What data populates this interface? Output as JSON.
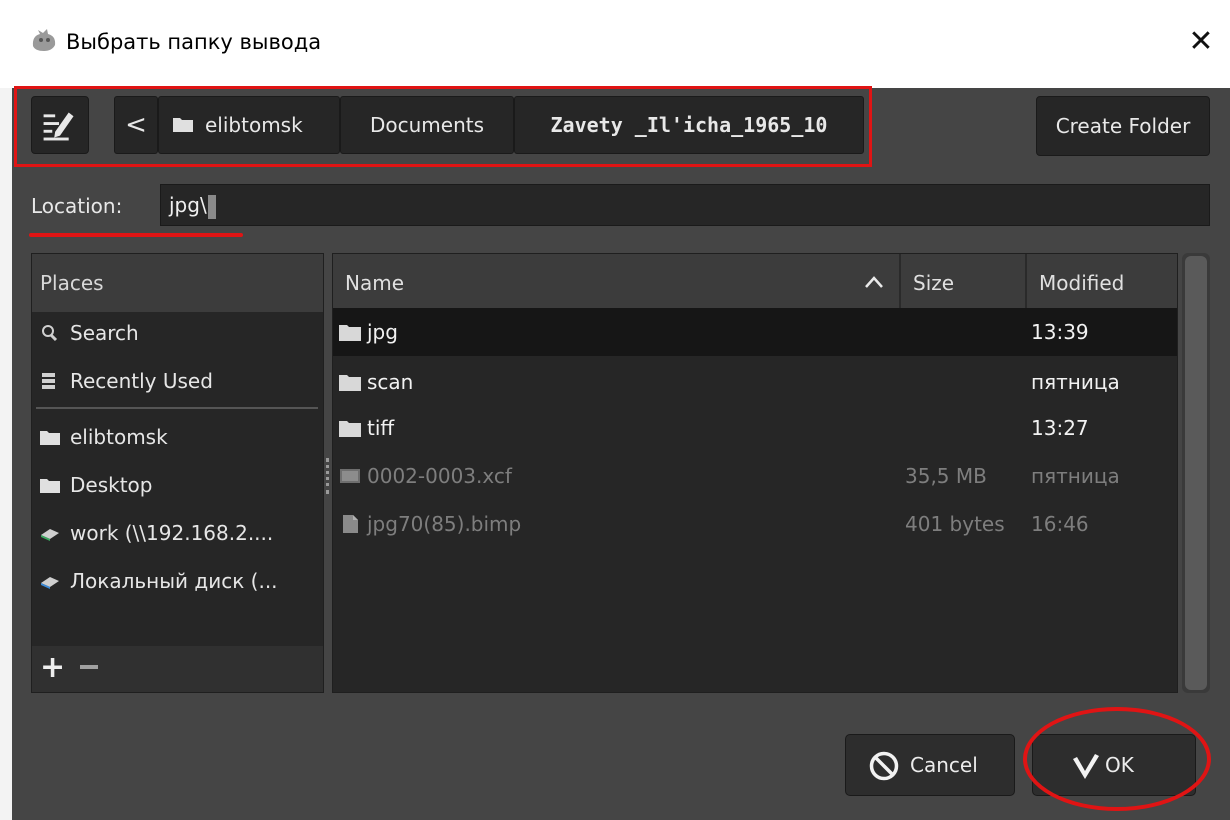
{
  "window": {
    "title": "Выбрать папку вывода",
    "close_glyph": "✕",
    "app_icon": "gimp-icon"
  },
  "pathbar": {
    "edit_icon": "edit-path-icon",
    "back_glyph": "<",
    "crumbs": [
      "elibtomsk",
      "Documents",
      "Zavety _Il'icha_1965_10"
    ],
    "create_folder_label": "Create Folder"
  },
  "location": {
    "label": "Location:",
    "value": "jpg\\"
  },
  "places": {
    "header": "Places",
    "items": [
      {
        "label": "Search",
        "icon": "search-icon"
      },
      {
        "label": "Recently Used",
        "icon": "recent-icon"
      },
      {
        "label": "elibtomsk",
        "icon": "folder-icon"
      },
      {
        "label": "Desktop",
        "icon": "folder-icon"
      },
      {
        "label": "work (\\\\192.168.2....",
        "icon": "network-drive-icon"
      },
      {
        "label": "Локальный диск (...",
        "icon": "local-disk-icon"
      }
    ],
    "add_glyph": "+"
  },
  "files": {
    "columns": {
      "name": "Name",
      "size": "Size",
      "modified": "Modified"
    },
    "rows": [
      {
        "name": "jpg",
        "size": "",
        "modified": "13:39",
        "type": "folder",
        "selected": true
      },
      {
        "name": "scan",
        "size": "",
        "modified": "пятница",
        "type": "folder",
        "selected": false
      },
      {
        "name": "tiff",
        "size": "",
        "modified": "13:27",
        "type": "folder",
        "selected": false
      },
      {
        "name": "0002-0003.xcf",
        "size": "35,5 MB",
        "modified": "пятница",
        "type": "file",
        "selected": false
      },
      {
        "name": "jpg70(85).bimp",
        "size": "401 bytes",
        "modified": "16:46",
        "type": "file",
        "selected": false
      }
    ]
  },
  "buttons": {
    "cancel": "Cancel",
    "ok": "OK"
  },
  "colors": {
    "dialog_bg": "#454545",
    "panel_bg": "#262626",
    "highlight_red": "#e01414"
  }
}
